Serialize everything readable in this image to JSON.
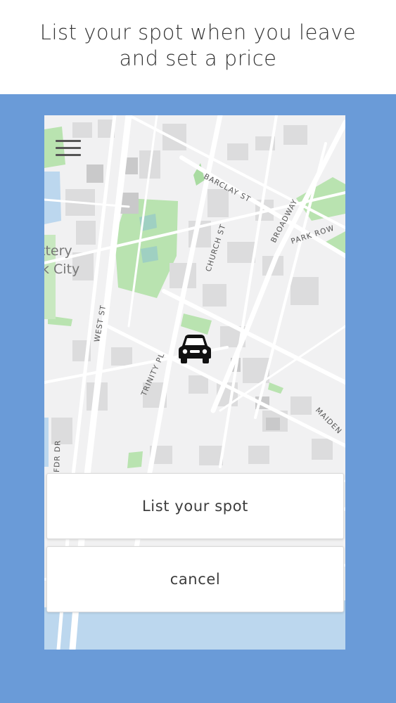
{
  "headline": {
    "line1": "List your spot when you leave",
    "line2": "and set a price"
  },
  "map": {
    "streets": {
      "barclay": "BARCLAY ST",
      "broadway": "BROADWAY",
      "park_row": "PARK ROW",
      "church": "CHURCH ST",
      "west": "WEST ST",
      "trinity": "TRINITY PL",
      "maiden": "MAIDEN",
      "fdr": "FDR DR"
    },
    "area_label_line1": "ttery",
    "area_label_line2": "k City"
  },
  "actions": {
    "list_spot": "List your spot",
    "cancel": "cancel"
  },
  "icons": {
    "menu": "hamburger-menu-icon",
    "marker": "car-icon"
  },
  "colors": {
    "backdrop": "#6a9bd8",
    "park_green": "#b9e3b0",
    "water": "#bcd7ee"
  }
}
